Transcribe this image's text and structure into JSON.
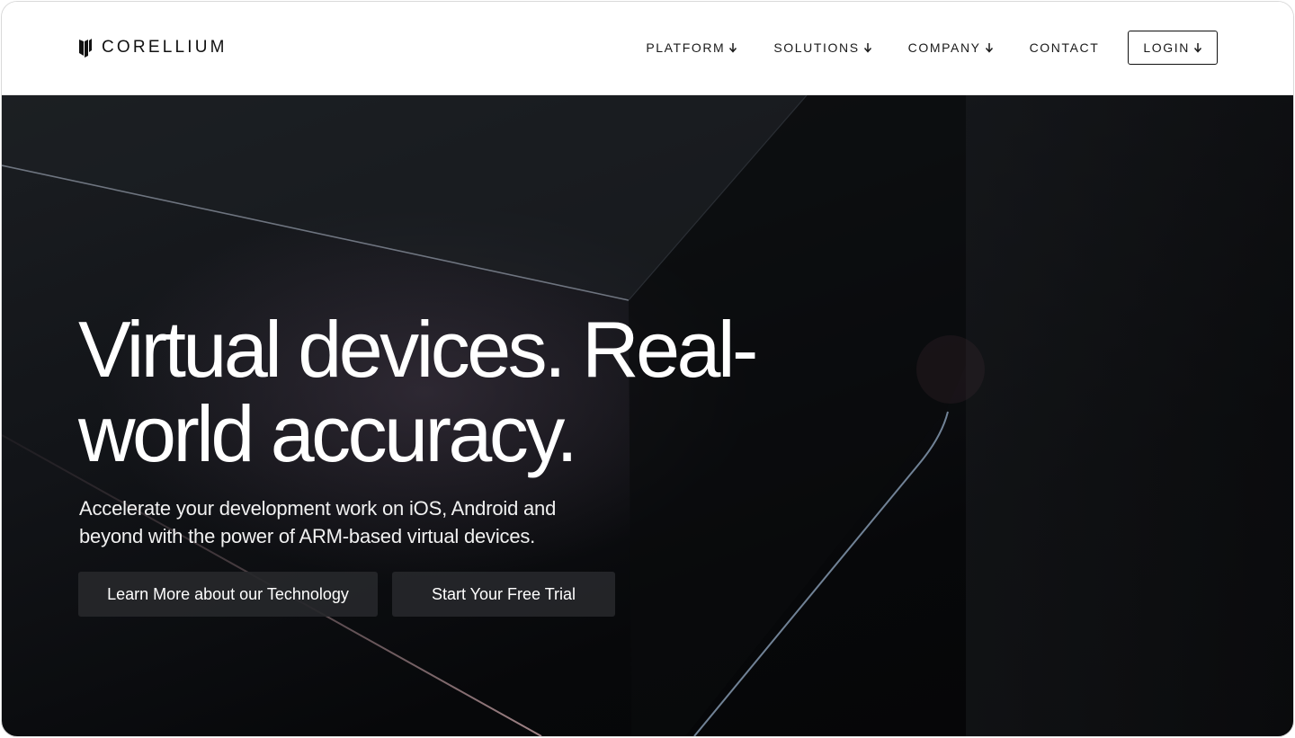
{
  "brand": {
    "name": "CORELLIUM",
    "logo_icon": "corellium-logo-icon"
  },
  "nav": {
    "items": [
      {
        "label": "PLATFORM",
        "icon": "arrow-down-icon"
      },
      {
        "label": "SOLUTIONS",
        "icon": "arrow-down-icon"
      },
      {
        "label": "COMPANY",
        "icon": "arrow-down-icon"
      },
      {
        "label": "CONTACT"
      }
    ],
    "login_label": "LOGIN"
  },
  "hero": {
    "title_line1": "Virtual devices. Real-",
    "title_line2": "world accuracy.",
    "subtitle_line1": "Accelerate your development work on iOS, Android and",
    "subtitle_line2": "beyond with the power of ARM-based virtual devices.",
    "primary_button": "Learn More about our Technology",
    "secondary_button": "Start Your Free Trial"
  },
  "colors": {
    "header_bg": "#ffffff",
    "hero_bg": "#0b0c0e",
    "button_bg": "#26272a",
    "text_dark": "#111111",
    "text_light": "#ffffff"
  }
}
